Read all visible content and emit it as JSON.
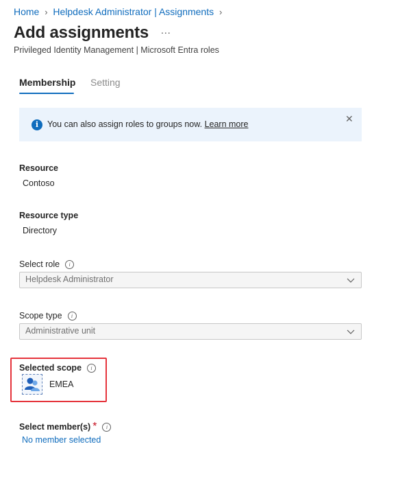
{
  "breadcrumb": {
    "items": [
      "Home",
      "Helpdesk Administrator | Assignments"
    ]
  },
  "header": {
    "title": "Add assignments",
    "more": "...",
    "subtitle": "Privileged Identity Management | Microsoft Entra roles"
  },
  "tabs": [
    {
      "label": "Membership",
      "active": true
    },
    {
      "label": "Setting",
      "active": false
    }
  ],
  "info_bar": {
    "text": "You can also assign roles to groups now.",
    "link": "Learn more",
    "icon": "info-icon",
    "close_icon": "close-icon"
  },
  "fields": {
    "resource": {
      "label": "Resource",
      "value": "Contoso"
    },
    "resource_type": {
      "label": "Resource type",
      "value": "Directory"
    },
    "select_role": {
      "label": "Select role",
      "value": "Helpdesk Administrator"
    },
    "scope_type": {
      "label": "Scope type",
      "value": "Administrative unit"
    },
    "selected_scope": {
      "label": "Selected scope",
      "value": "EMEA",
      "icon": "administrative-unit-icon"
    },
    "select_members": {
      "label": "Select member(s)",
      "required_mark": "*",
      "value": "No member selected"
    }
  },
  "colors": {
    "accent": "#0f6cbd",
    "info_bar_bg": "#ebf3fc",
    "highlight": "#e5333b"
  }
}
